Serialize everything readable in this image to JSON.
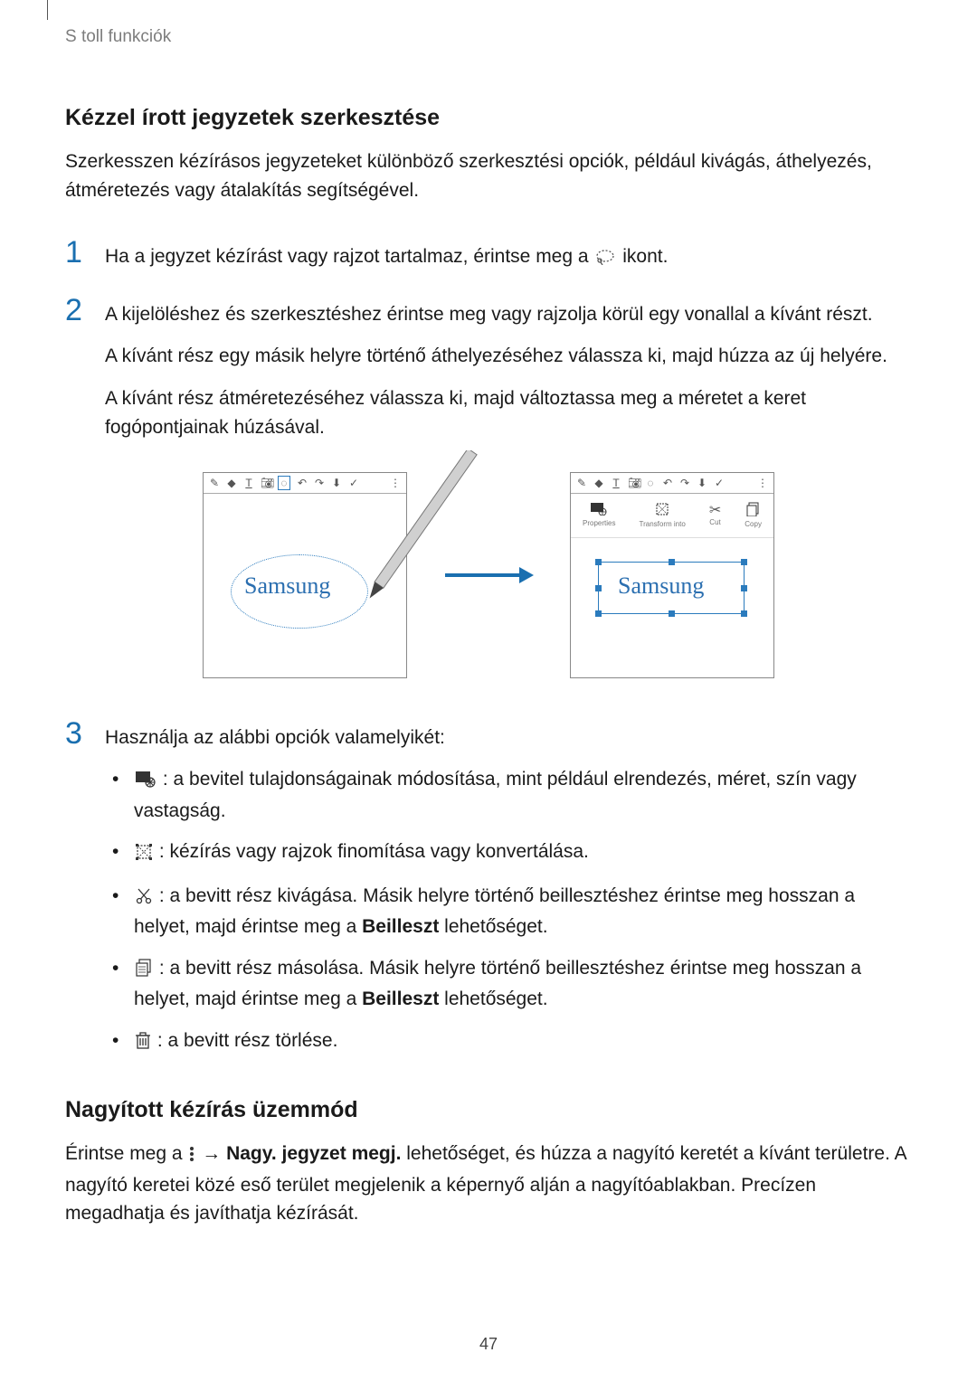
{
  "breadcrumb": "S toll funkciók",
  "section1": {
    "heading": "Kézzel írott jegyzetek szerkesztése",
    "intro": "Szerkesszen kézírásos jegyzeteket különböző szerkesztési opciók, például kivágás, áthelyezés, átméretezés vagy átalakítás segítségével.",
    "steps": {
      "s1": {
        "num": "1",
        "before": "Ha a jegyzet kézírást vagy rajzot tartalmaz, érintse meg a ",
        "after": " ikont."
      },
      "s2": {
        "num": "2",
        "p1": "A kijelöléshez és szerkesztéshez érintse meg vagy rajzolja körül egy vonallal a kívánt részt.",
        "p2": "A kívánt rész egy másik helyre történő áthelyezéséhez válassza ki, majd húzza az új helyére.",
        "p3": "A kívánt rész átméretezéséhez válassza ki, majd változtassa meg a méretet a keret fogópontjainak húzásával."
      },
      "s3": {
        "num": "3",
        "lead": "Használja az alábbi opciók valamelyikét:",
        "options": {
          "o1": " : a bevitel tulajdonságainak módosítása, mint például elrendezés, méret, szín vagy vastagság.",
          "o2": " : kézírás vagy rajzok finomítása vagy konvertálása.",
          "o3_a": " : a bevitt rész kivágása. Másik helyre történő beillesztéshez érintse meg hosszan a helyet, majd érintse meg a ",
          "o3_b": "Beilleszt",
          "o3_c": " lehetőséget.",
          "o4_a": " : a bevitt rész másolása. Másik helyre történő beillesztéshez érintse meg hosszan a helyet, majd érintse meg a ",
          "o4_b": "Beilleszt",
          "o4_c": " lehetőséget.",
          "o5": " : a bevitt rész törlése."
        }
      }
    }
  },
  "illustration": {
    "handwritten": "Samsung",
    "edit_labels": {
      "properties": "Properties",
      "transform": "Transform into",
      "cut": "Cut",
      "copy": "Copy"
    }
  },
  "section2": {
    "heading": "Nagyított kézírás üzemmód",
    "p_a": "Érintse meg a ",
    "p_b": " → ",
    "p_bold": "Nagy. jegyzet megj.",
    "p_c": " lehetőséget, és húzza a nagyító keretét a kívánt területre. A nagyító keretei közé eső terület megjelenik a képernyő alján a nagyítóablakban. Precízen megadhatja és javíthatja kézírását."
  },
  "page_number": "47"
}
